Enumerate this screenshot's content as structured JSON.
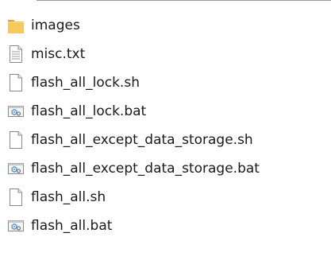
{
  "files": [
    {
      "name": "images",
      "icon": "folder-icon"
    },
    {
      "name": "misc.txt",
      "icon": "text-file-icon"
    },
    {
      "name": "flash_all_lock.sh",
      "icon": "blank-file-icon"
    },
    {
      "name": "flash_all_lock.bat",
      "icon": "batch-file-icon"
    },
    {
      "name": "flash_all_except_data_storage.sh",
      "icon": "blank-file-icon"
    },
    {
      "name": "flash_all_except_data_storage.bat",
      "icon": "batch-file-icon"
    },
    {
      "name": "flash_all.sh",
      "icon": "blank-file-icon"
    },
    {
      "name": "flash_all.bat",
      "icon": "batch-file-icon"
    }
  ],
  "colors": {
    "folder": "#f5c95a",
    "folder_dark": "#e0a93a",
    "text": "#1a1a1a",
    "file_outline": "#8a8a8a",
    "gear": "#5b9bd5"
  }
}
